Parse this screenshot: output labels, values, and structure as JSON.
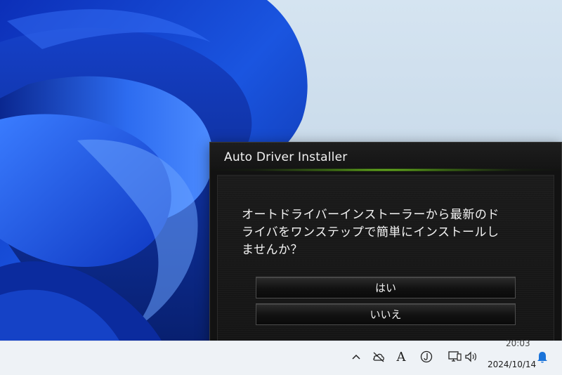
{
  "dialog": {
    "title": "Auto Driver Installer",
    "message_line1": "オートドライバーインストーラーから最新のド",
    "message_line2": "ライバをワンステップで簡単にインストールし",
    "message_line3": "ませんか？",
    "yes_label": "はい",
    "no_label": "いいえ",
    "accent_color": "#8ce628"
  },
  "taskbar": {
    "tray_icons": [
      "chevron-up-icon",
      "cloud-offline-icon",
      "ime-mode-icon",
      "japanese-input-icon",
      "network-icon",
      "volume-icon",
      "notification-bell-icon"
    ],
    "ime_mode_label": "A",
    "clock_time": "20:03",
    "clock_date": "2024/10/14",
    "bell_color": "#1a73d9"
  }
}
